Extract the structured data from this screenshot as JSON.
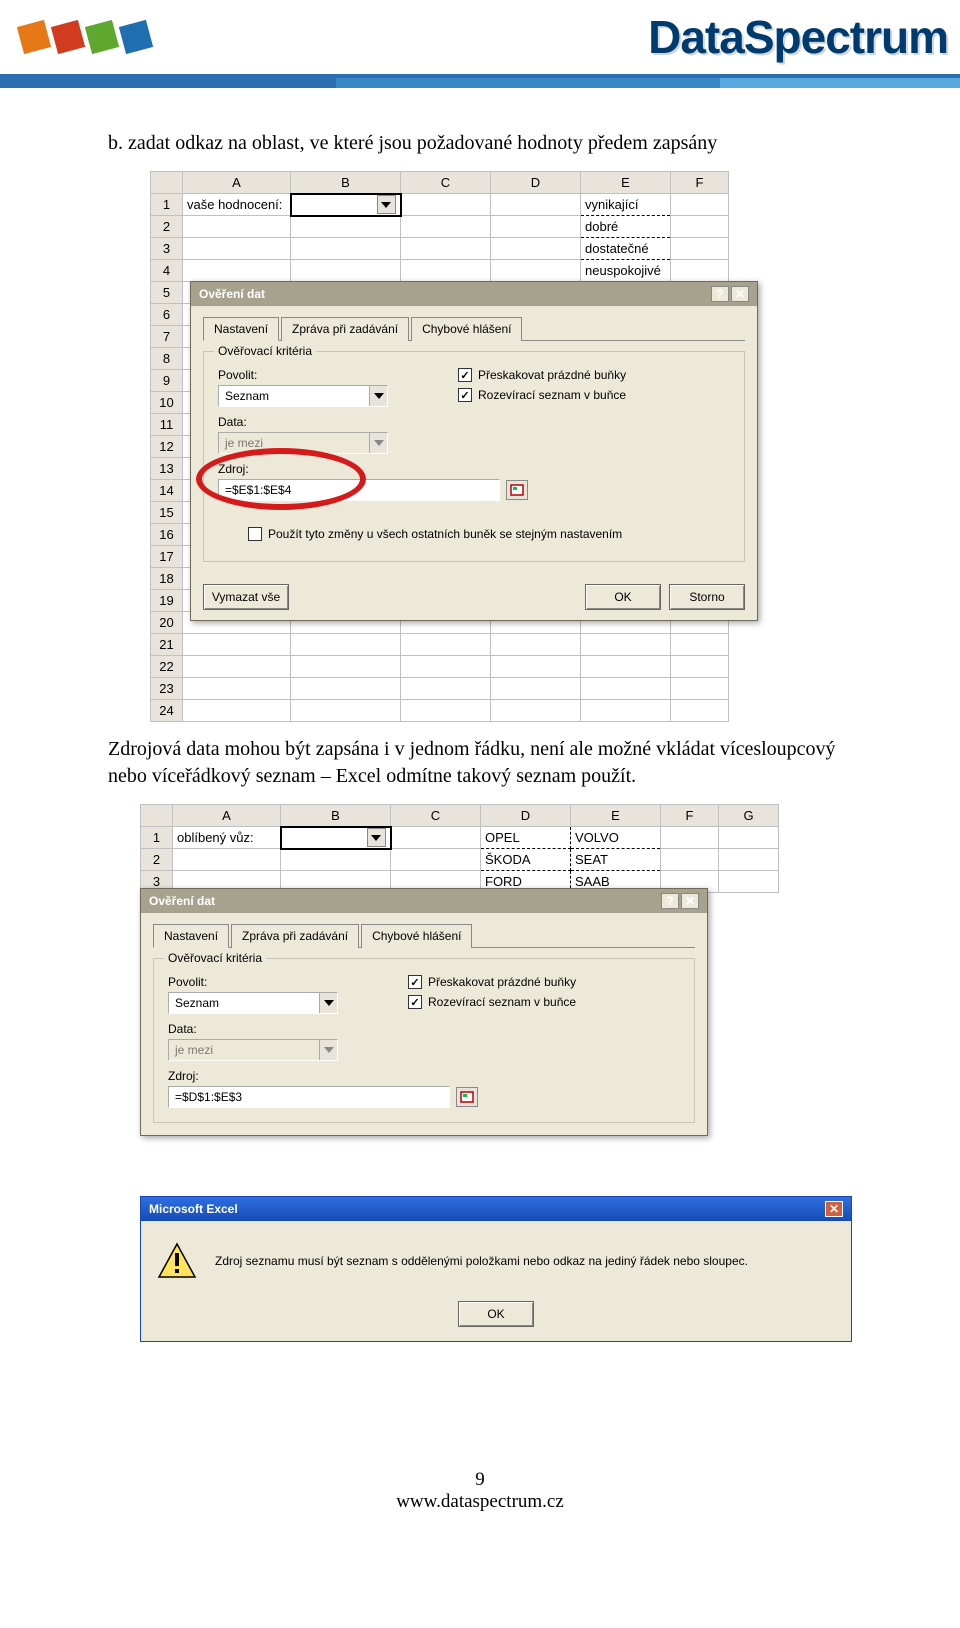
{
  "header": {
    "brand": "DataSpectrum"
  },
  "text": {
    "line1": "b.  zadat odkaz na oblast, ve které jsou požadované hodnoty předem zapsány",
    "line2": "Zdrojová data mohou být zapsána i v jednom řádku, není ale možné vkládat vícesloupcový nebo víceřádkový seznam – Excel odmítne takový seznam použít."
  },
  "fig1": {
    "columns": [
      "A",
      "B",
      "C",
      "D",
      "E",
      "F"
    ],
    "rows": [
      {
        "n": "1",
        "a": "vaše hodnocení:",
        "e": "vynikající"
      },
      {
        "n": "2",
        "e": "dobré"
      },
      {
        "n": "3",
        "e": "dostatečné"
      },
      {
        "n": "4",
        "e": "neuspokojivé"
      },
      {
        "n": "5"
      },
      {
        "n": "6"
      },
      {
        "n": "7"
      },
      {
        "n": "8"
      },
      {
        "n": "9"
      },
      {
        "n": "10"
      },
      {
        "n": "11"
      },
      {
        "n": "12"
      },
      {
        "n": "13"
      },
      {
        "n": "14"
      },
      {
        "n": "15"
      },
      {
        "n": "16"
      },
      {
        "n": "17"
      },
      {
        "n": "18"
      },
      {
        "n": "19"
      },
      {
        "n": "20"
      },
      {
        "n": "21"
      },
      {
        "n": "22"
      },
      {
        "n": "23"
      },
      {
        "n": "24"
      }
    ],
    "dialog": {
      "title": "Ověření dat",
      "tabs": [
        "Nastavení",
        "Zpráva při zadávání",
        "Chybové hlášení"
      ],
      "legend": "Ověřovací kritéria",
      "allow_label": "Povolit:",
      "allow_value": "Seznam",
      "data_label": "Data:",
      "data_value": "je mezi",
      "source_label": "Zdroj:",
      "source_value": "=$E$1:$E$4",
      "chk_skip": "Přeskakovat prázdné buňky",
      "chk_dropdown": "Rozevírací seznam v buňce",
      "chk_apply": "Použít tyto změny u všech ostatních buněk se stejným nastavením",
      "btn_clear": "Vymazat vše",
      "btn_ok": "OK",
      "btn_cancel": "Storno"
    }
  },
  "fig2": {
    "columns": [
      "A",
      "B",
      "C",
      "D",
      "E",
      "F",
      "G"
    ],
    "rows": [
      {
        "n": "1",
        "a": "oblíbený vůz:",
        "d": "OPEL",
        "e": "VOLVO"
      },
      {
        "n": "2",
        "d": "ŠKODA",
        "e": "SEAT"
      },
      {
        "n": "3",
        "d": "FORD",
        "e": "SAAB"
      }
    ],
    "dialog": {
      "title": "Ověření dat",
      "tabs": [
        "Nastavení",
        "Zpráva při zadávání",
        "Chybové hlášení"
      ],
      "legend": "Ověřovací kritéria",
      "allow_label": "Povolit:",
      "allow_value": "Seznam",
      "data_label": "Data:",
      "data_value": "je mezi",
      "source_label": "Zdroj:",
      "source_value": "=$D$1:$E$3",
      "chk_skip": "Přeskakovat prázdné buňky",
      "chk_dropdown": "Rozevírací seznam v buňce"
    },
    "msgbox": {
      "title": "Microsoft Excel",
      "text": "Zdroj seznamu musí být seznam s oddělenými položkami nebo odkaz na jediný řádek nebo sloupec.",
      "btn_ok": "OK"
    }
  },
  "footer": {
    "page": "9",
    "url": "www.dataspectrum.cz"
  }
}
